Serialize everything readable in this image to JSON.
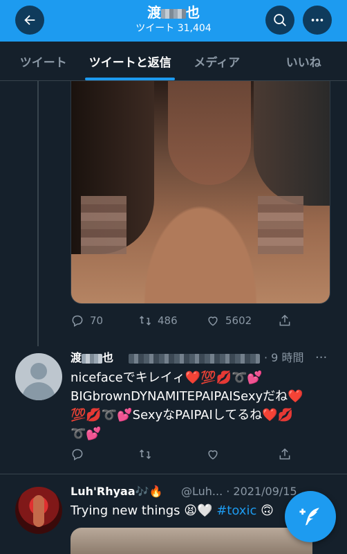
{
  "header": {
    "name_prefix": "渡",
    "name_suffix": "也",
    "tweet_count_label": "ツイート 31,404"
  },
  "tabs": [
    {
      "label": "ツイート"
    },
    {
      "label": "ツイートと返信"
    },
    {
      "label": "メディア"
    },
    {
      "label": "いいね"
    }
  ],
  "photo_tweet": {
    "replies": "70",
    "retweets": "486",
    "likes": "5602"
  },
  "reply_tweet": {
    "name_prefix": "渡",
    "name_suffix": "也",
    "time": "· 9 時間",
    "more": "···",
    "line1": "nicefaceでキレイィ❤️💯💋➰💕",
    "line2": "BIGbrownDYNAMITEPAIPAISexyだね❤️",
    "line3": "💯💋➰💕SexyなPAIPAIしてるね❤️💋",
    "line4": "➰💕"
  },
  "last_tweet": {
    "name": "Luh'Rhyaa🎶🔥",
    "handle": "@Luh... · 2021/09/15",
    "text": "Trying new things 😫🤍",
    "hashtag": "#toxic",
    "trailing_emoji": "🙃"
  },
  "colors": {
    "background": "#15202b",
    "accent": "#1d9bf0",
    "secondary_text": "#8b98a5",
    "border": "#38444d"
  }
}
